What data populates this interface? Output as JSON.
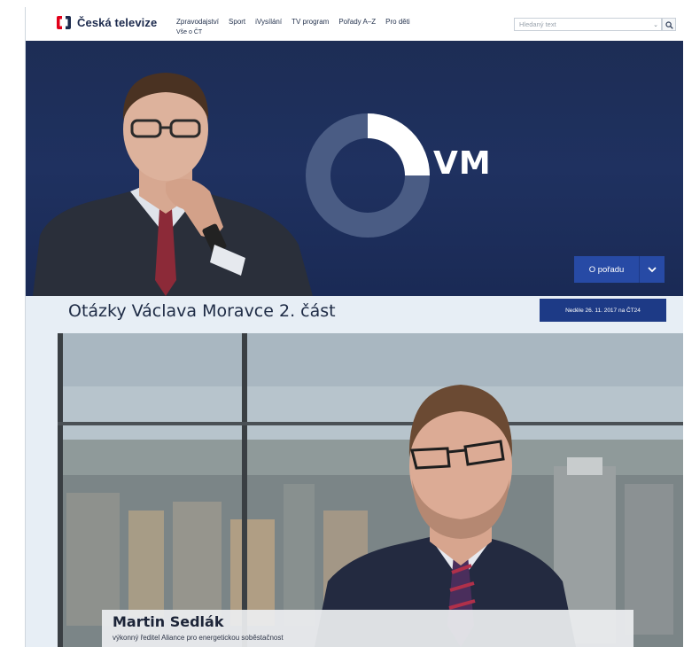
{
  "site": {
    "name": "Česká televize"
  },
  "nav": {
    "items": [
      {
        "label": "Zpravodajství"
      },
      {
        "label": "Sport"
      },
      {
        "label": "iVysílání"
      },
      {
        "label": "TV program"
      },
      {
        "label": "Pořady A–Z"
      },
      {
        "label": "Pro děti"
      }
    ],
    "sub_label": "Vše o ČT"
  },
  "search": {
    "placeholder": "Hledaný text"
  },
  "hero": {
    "show_logo_text": "VM",
    "about_button_label": "O pořadu"
  },
  "episode": {
    "title": "Otázky Václava Moravce 2. část",
    "air_info": "Neděle 26. 11. 2017 na ČT24"
  },
  "video": {
    "caption_name": "Martin Sedlák",
    "caption_role": "výkonný ředitel Aliance pro energetickou soběstačnost"
  },
  "colors": {
    "brand_navy": "#1d3a86",
    "button_blue": "#274aa5",
    "hero_background": "#1f3160"
  }
}
